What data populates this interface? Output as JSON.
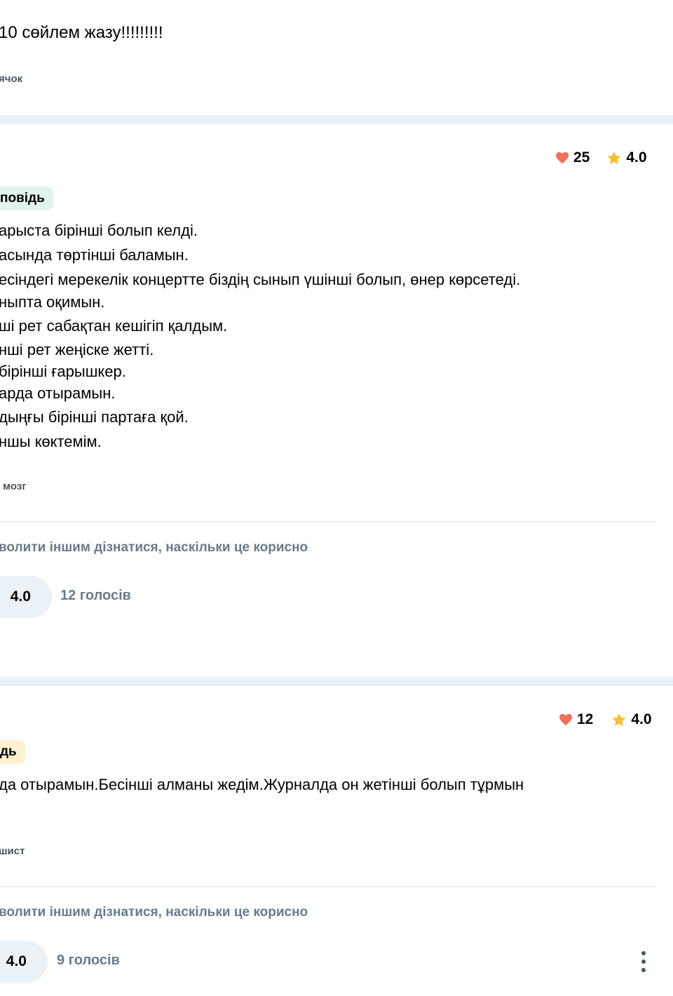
{
  "question": {
    "title": "10 сөйлем жазу!!!!!!!!!",
    "asker": "ячок"
  },
  "answers": [
    {
      "likes": "25",
      "rating": "4.0",
      "badge": "повідь",
      "lines": [
        "арыста бірінші болып келді.",
        "асында төртінші баламын.",
        "есіндегі мерекелік концертте біздің сынып үшінші болып, өнер көрсетеді.",
        "ныпта оқимын.",
        "ші рет сабақтан кешігіп қалдым.",
        "нші рет жеңіске жетті.",
        "бірінші ғарышкер.",
        "арда отырамын.",
        "дыңғы бірінші партаға қой.",
        "ншы көктемім."
      ],
      "author": "мозг",
      "prompt": "волити іншим дізнатися, наскільки це корисно",
      "avg_rating": "4.0",
      "votes": "12 голосів"
    },
    {
      "likes": "12",
      "rating": "4.0",
      "badge": "дь",
      "lines": [
        "да отырамын.Бесінші алманы жедім.Журналда он жетінші болып тұрмын"
      ],
      "author": "шист",
      "prompt": "волити іншим дізнатися, наскільки це корисно",
      "avg_rating": "4.0",
      "votes": "9 голосів"
    }
  ],
  "icons": {
    "heart": "heart-icon",
    "star": "star-icon",
    "more": "more-vertical-icon"
  },
  "colors": {
    "heart": "#f0705a",
    "star": "#fbbe2e",
    "muted": "#687b8c",
    "separator": "#ebf2f7",
    "badge_green": "#e2f5ec",
    "badge_yellow": "#fdf1cf"
  }
}
